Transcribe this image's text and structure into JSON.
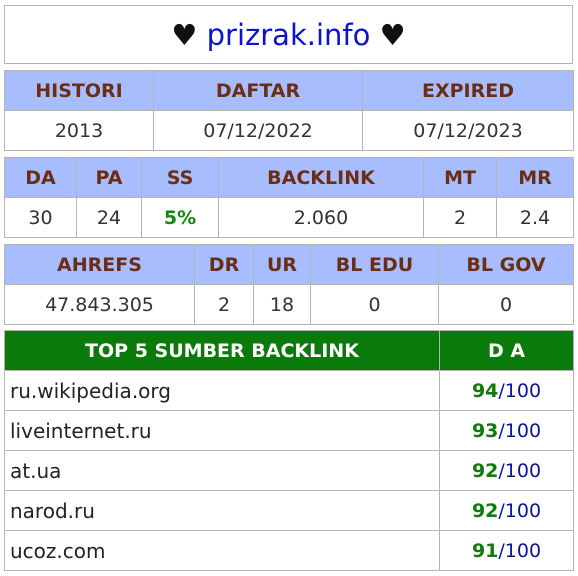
{
  "title": {
    "heart_left": "♥",
    "domain": "prizrak.info",
    "heart_right": "♥"
  },
  "history": {
    "headers": [
      "HISTORI",
      "DAFTAR",
      "EXPIRED"
    ],
    "values": [
      "2013",
      "07/12/2022",
      "07/12/2023"
    ]
  },
  "metrics": {
    "headers": [
      "DA",
      "PA",
      "SS",
      "BACKLINK",
      "MT",
      "MR"
    ],
    "values": [
      "30",
      "24",
      "5%",
      "2.060",
      "2",
      "2.4"
    ]
  },
  "ahrefs": {
    "headers": [
      "AHREFS",
      "DR",
      "UR",
      "BL EDU",
      "BL GOV"
    ],
    "values": [
      "47.843.305",
      "2",
      "18",
      "0",
      "0"
    ]
  },
  "top_backlinks": {
    "header_source": "TOP 5 SUMBER BACKLINK",
    "header_da": "D A",
    "separator": "/",
    "rows": [
      {
        "site": "ru.wikipedia.org",
        "da": "94",
        "max": "100"
      },
      {
        "site": "liveinternet.ru",
        "da": "93",
        "max": "100"
      },
      {
        "site": "at.ua",
        "da": "92",
        "max": "100"
      },
      {
        "site": "narod.ru",
        "da": "92",
        "max": "100"
      },
      {
        "site": "ucoz.com",
        "da": "91",
        "max": "100"
      }
    ]
  },
  "colors": {
    "header_bg": "#a8bdfd",
    "header_text": "#6b2d14",
    "top_header_bg": "#0a7a0a",
    "domain_text": "#0a14c8",
    "good_value": "#0f8a0f"
  }
}
